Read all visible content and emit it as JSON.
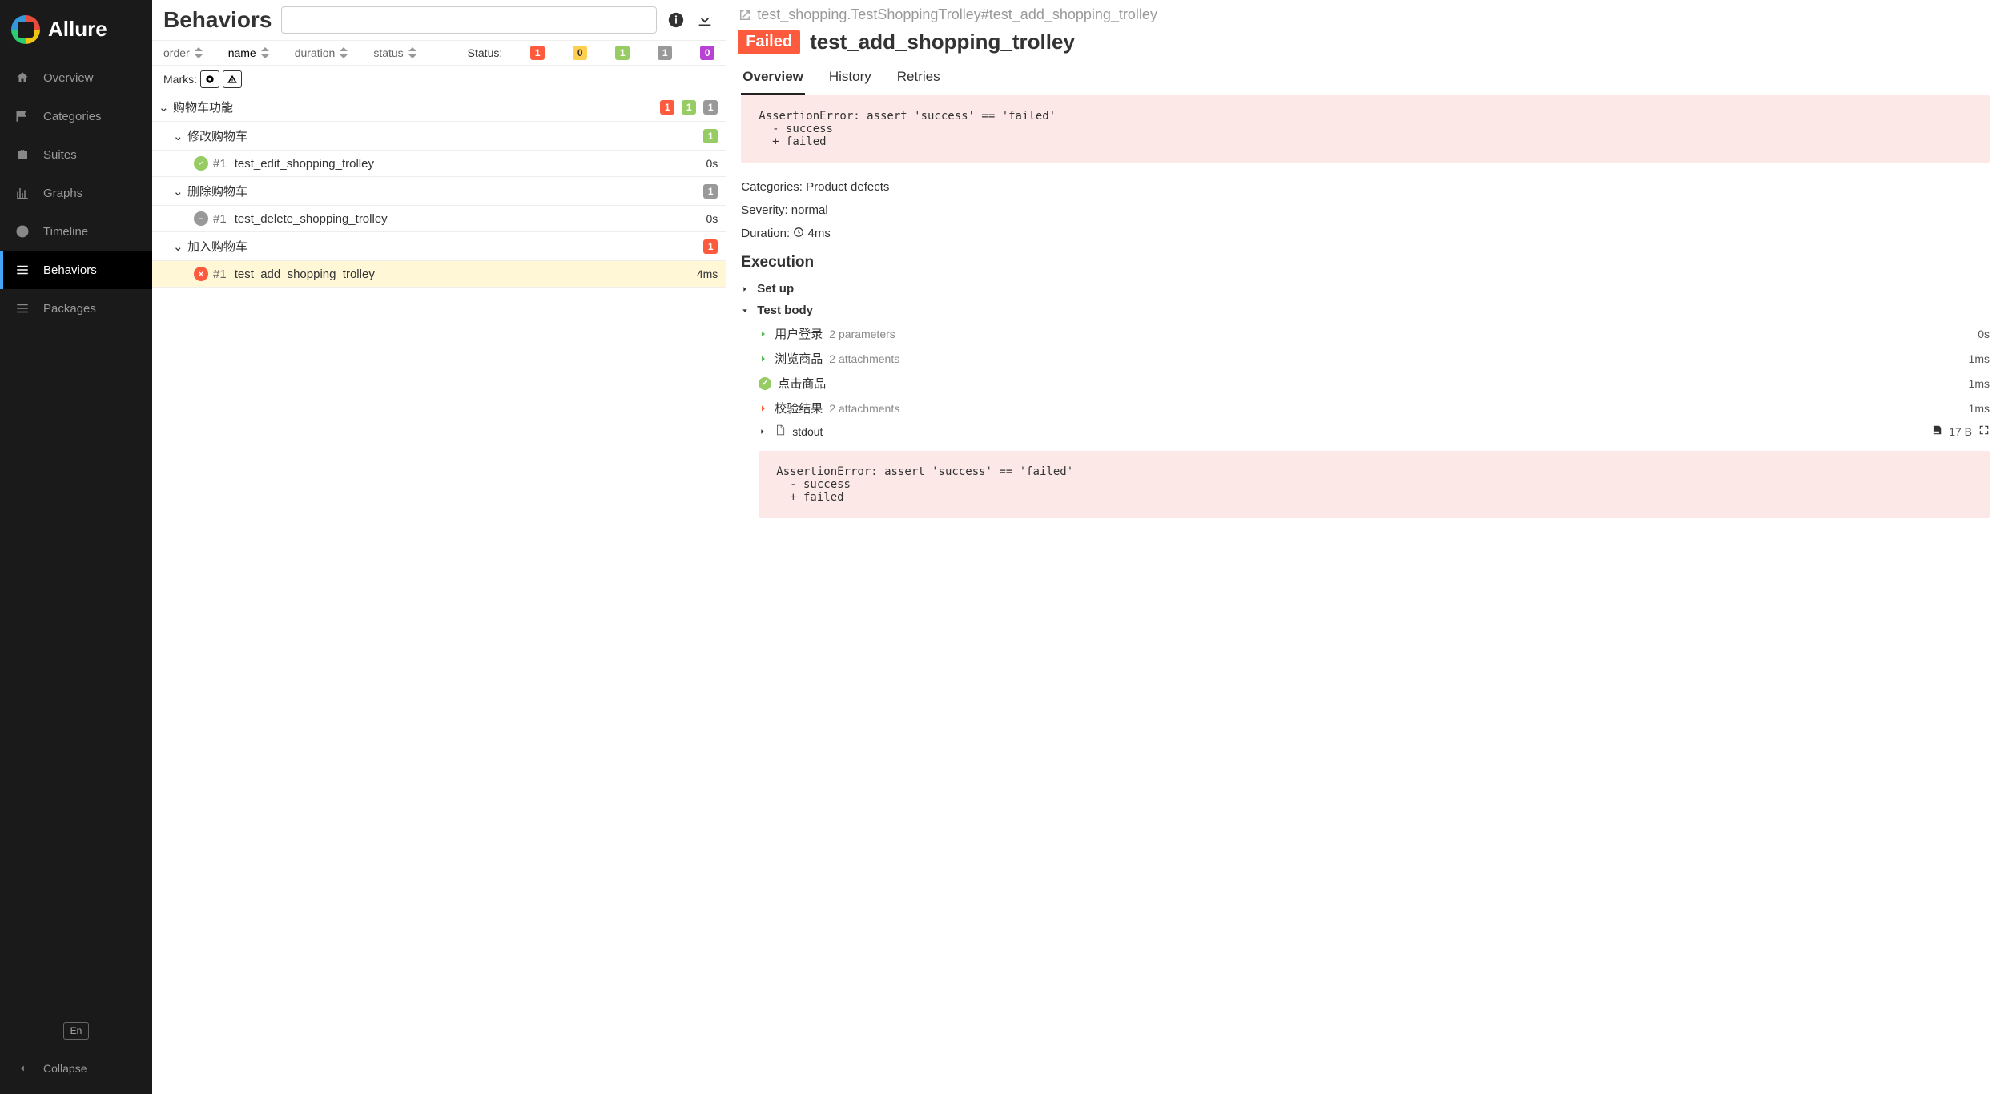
{
  "app": {
    "name": "Allure"
  },
  "sidebar": {
    "items": [
      {
        "label": "Overview"
      },
      {
        "label": "Categories"
      },
      {
        "label": "Suites"
      },
      {
        "label": "Graphs"
      },
      {
        "label": "Timeline"
      },
      {
        "label": "Behaviors"
      },
      {
        "label": "Packages"
      }
    ],
    "language": "En",
    "collapse": "Collapse"
  },
  "middle": {
    "title": "Behaviors",
    "sort": {
      "order": "order",
      "name": "name",
      "duration": "duration",
      "status": "status"
    },
    "status_label": "Status:",
    "status_counts": {
      "red": "1",
      "yellow": "0",
      "green": "1",
      "gray": "1",
      "purple": "0"
    },
    "marks_label": "Marks:",
    "tree": {
      "group0": {
        "label": "购物车功能",
        "badges": {
          "red": "1",
          "green": "1",
          "gray": "1"
        }
      },
      "group1": {
        "label": "修改购物车",
        "badge": "1",
        "test": {
          "num": "#1",
          "name": "test_edit_shopping_trolley",
          "dur": "0s"
        }
      },
      "group2": {
        "label": "删除购物车",
        "badge": "1",
        "test": {
          "num": "#1",
          "name": "test_delete_shopping_trolley",
          "dur": "0s"
        }
      },
      "group3": {
        "label": "加入购物车",
        "badge": "1",
        "test": {
          "num": "#1",
          "name": "test_add_shopping_trolley",
          "dur": "4ms"
        }
      }
    }
  },
  "detail": {
    "breadcrumb": "test_shopping.TestShoppingTrolley#test_add_shopping_trolley",
    "status_badge": "Failed",
    "title": "test_add_shopping_trolley",
    "tabs": {
      "overview": "Overview",
      "history": "History",
      "retries": "Retries"
    },
    "error_text": "AssertionError: assert 'success' == 'failed'\n  - success\n  + failed",
    "meta": {
      "categories_label": "Categories:",
      "categories_value": "Product defects",
      "severity_label": "Severity:",
      "severity_value": "normal",
      "duration_label": "Duration:",
      "duration_value": "4ms"
    },
    "execution_heading": "Execution",
    "setup_label": "Set up",
    "testbody_label": "Test body",
    "steps": [
      {
        "name": "用户登录",
        "sub": "2 parameters",
        "dur": "0s"
      },
      {
        "name": "浏览商品",
        "sub": "2 attachments",
        "dur": "1ms"
      },
      {
        "name": "点击商品",
        "sub": "",
        "dur": "1ms"
      },
      {
        "name": "校验结果",
        "sub": "2 attachments",
        "dur": "1ms"
      }
    ],
    "stdout": {
      "label": "stdout",
      "size": "17 B"
    },
    "inner_error": "AssertionError: assert 'success' == 'failed'\n  - success\n  + failed"
  }
}
